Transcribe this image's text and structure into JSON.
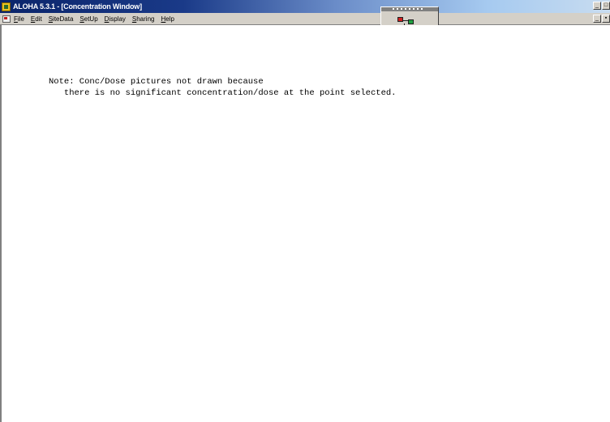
{
  "window": {
    "title": "ALOHA 5.3.1 - [Concentration Window]"
  },
  "title_controls": {
    "minimize_glyph": "_",
    "restore_glyph": "□"
  },
  "menu": {
    "items": [
      "File",
      "Edit",
      "SiteData",
      "SetUp",
      "Display",
      "Sharing",
      "Help"
    ]
  },
  "doc_controls": {
    "minimize_glyph": "_",
    "restore_glyph": "▪"
  },
  "message": {
    "line1": "Note: Conc/Dose pictures not drawn because",
    "line2": "   there is no significant concentration/dose at the point selected."
  },
  "colors": {
    "titlebar_start": "#0a246a",
    "titlebar_end": "#c8dcf0",
    "face": "#d4d0c8",
    "client_bg": "#ffffff"
  }
}
